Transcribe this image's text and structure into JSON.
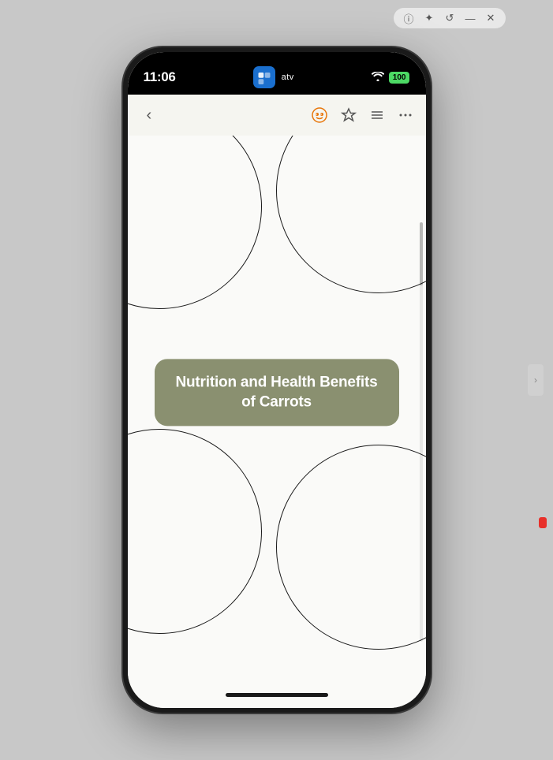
{
  "window": {
    "chrome_icons": [
      "info",
      "star",
      "history",
      "minimize",
      "close"
    ]
  },
  "status_bar": {
    "time": "11:06",
    "app_label": "atv",
    "wifi": "WiFi",
    "battery": "100"
  },
  "nav_bar": {
    "back_label": "‹",
    "icon_monster": "👹",
    "icon_pin": "☆",
    "icon_list": "≡",
    "icon_more": "···"
  },
  "mind_map": {
    "central_node_text": "Nutrition and Health Benefits of Carrots"
  },
  "colors": {
    "node_bg": "#8a9070",
    "node_text": "#ffffff",
    "circle_stroke": "#1a1a1a",
    "screen_bg": "#fafaf8"
  }
}
